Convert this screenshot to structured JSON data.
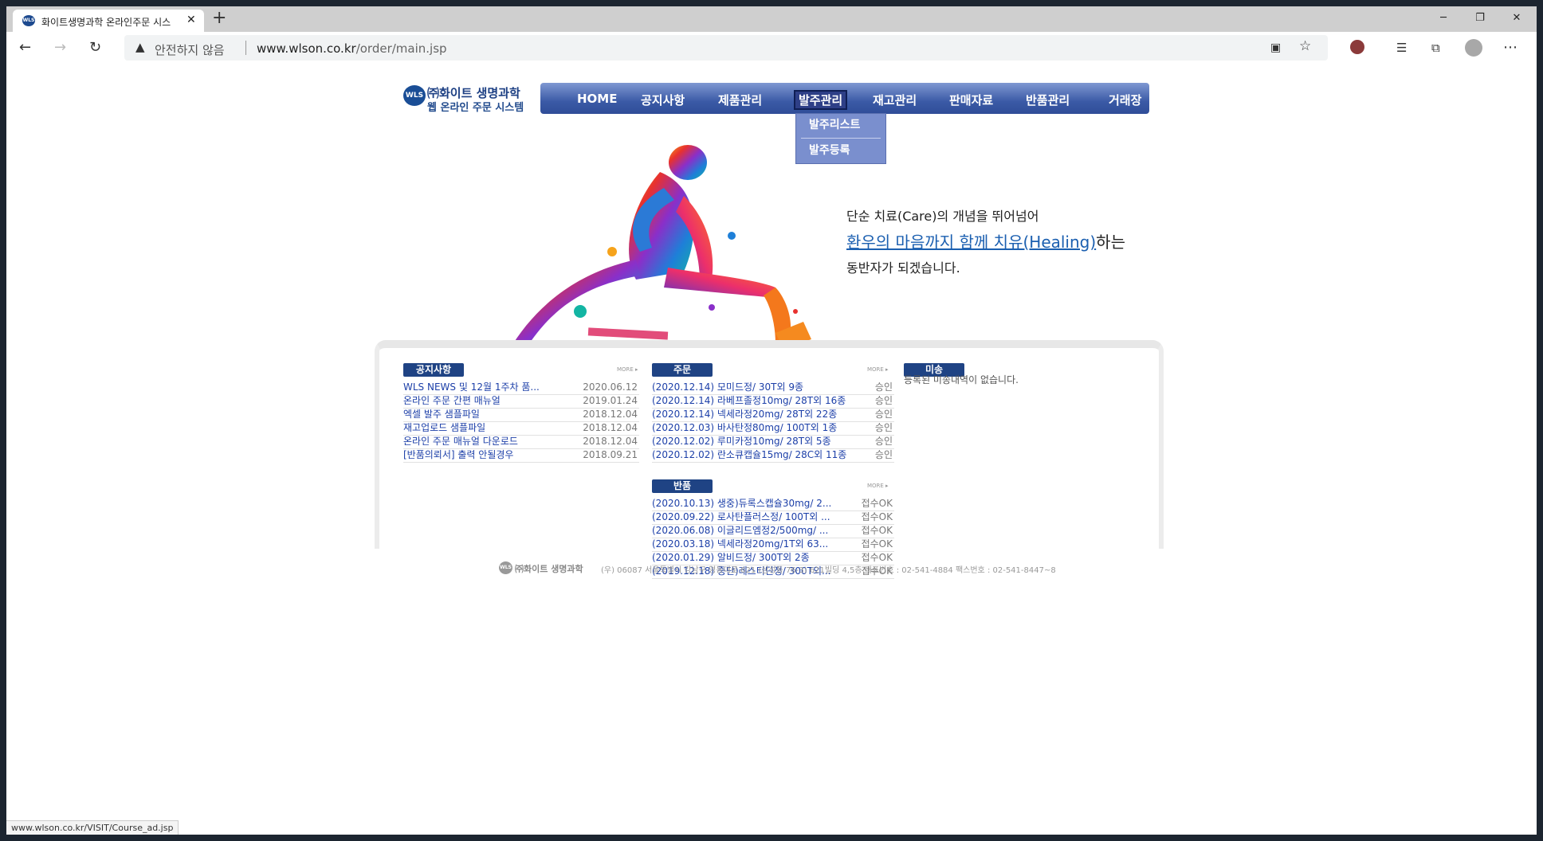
{
  "browser": {
    "tab_title": "화이트생명과학 온라인주문 시스",
    "insecure_label": "안전하지 않음",
    "url_host": "www.wlson.co.kr",
    "url_path": "/order/main.jsp",
    "status_url": "www.wlson.co.kr/VISIT/Course_ad.jsp",
    "favicon_text": "WLS"
  },
  "logo": {
    "mark": "WLS",
    "name": "㈜화이트 생명과학",
    "subtitle": "웹 온라인 주문 시스템"
  },
  "nav": [
    {
      "label": "HOME"
    },
    {
      "label": "공지사항"
    },
    {
      "label": "제품관리"
    },
    {
      "label": "발주관리"
    },
    {
      "label": "재고관리"
    },
    {
      "label": "판매자료"
    },
    {
      "label": "반품관리"
    },
    {
      "label": "거래장"
    }
  ],
  "dropdown": [
    "발주리스트",
    "발주등록"
  ],
  "tagline": {
    "line1": "단순 치료(Care)의 개념을 뛰어넘어",
    "line2_highlight": "환우의 마음까지 함께 치유(Healing)",
    "line2_rest": "하는",
    "line3": "동반자가 되겠습니다."
  },
  "notice": {
    "title": "공지사항",
    "more": "MORE ▸",
    "rows": [
      {
        "text": "WLS NEWS 및 12월 1주차 품...",
        "date": "2020.06.12"
      },
      {
        "text": "온라인 주문 간편 매뉴얼",
        "date": "2019.01.24"
      },
      {
        "text": "엑셀 발주 샘플파일",
        "date": "2018.12.04"
      },
      {
        "text": "재고업로드 샘플파일",
        "date": "2018.12.04"
      },
      {
        "text": "온라인 주문 매뉴얼 다운로드",
        "date": "2018.12.04"
      },
      {
        "text": "[반품의뢰서] 출력 안될경우",
        "date": "2018.09.21"
      }
    ]
  },
  "orders": {
    "title": "주문",
    "more": "MORE ▸",
    "rows": [
      {
        "text": "(2020.12.14) 모미드정/ 30T외 9종",
        "status": "승인"
      },
      {
        "text": "(2020.12.14) 라베프졸정10mg/ 28T외 16종",
        "status": "승인"
      },
      {
        "text": "(2020.12.14) 넥세라정20mg/ 28T외 22종",
        "status": "승인"
      },
      {
        "text": "(2020.12.03) 바사탄정80mg/ 100T외 1종",
        "status": "승인"
      },
      {
        "text": "(2020.12.02) 루미카정10mg/ 28T외 5종",
        "status": "승인"
      },
      {
        "text": "(2020.12.02) 란소큐캡슐15mg/ 28C외 11종",
        "status": "승인"
      }
    ]
  },
  "returns": {
    "title": "반품",
    "more": "MORE ▸",
    "rows": [
      {
        "text": "(2020.10.13) 생중)듀록스캡슐30mg/ 2...",
        "status": "접수OK"
      },
      {
        "text": "(2020.09.22) 로사탄플러스정/ 100T외 ...",
        "status": "접수OK"
      },
      {
        "text": "(2020.06.08) 이글리드엠정2/500mg/ ...",
        "status": "접수OK"
      },
      {
        "text": "(2020.03.18) 넥세라정20mg/1T외 63...",
        "status": "접수OK"
      },
      {
        "text": "(2020.01.29) 알비드정/ 300T외 2종",
        "status": "접수OK"
      },
      {
        "text": "(2019.12.18) 중단)레스티딘정/ 300T외...",
        "status": "접수OK"
      }
    ]
  },
  "unsent": {
    "title": "미송",
    "empty": "등록된 미송내역이 없습니다."
  },
  "footer": {
    "mark": "WLS",
    "name": "㈜화이트 생명과학",
    "address": "(우) 06087 서울특별시 강남구 영동대로 621 (삼성동 76-3) 621빌딩 4,5층   대표번호 : 02-541-4884 팩스번호 : 02-541-8447~8"
  },
  "colors": {
    "nav_blue": "#3b5aa6",
    "link_blue": "#1c3fa8",
    "pill_navy": "#1f4384"
  }
}
